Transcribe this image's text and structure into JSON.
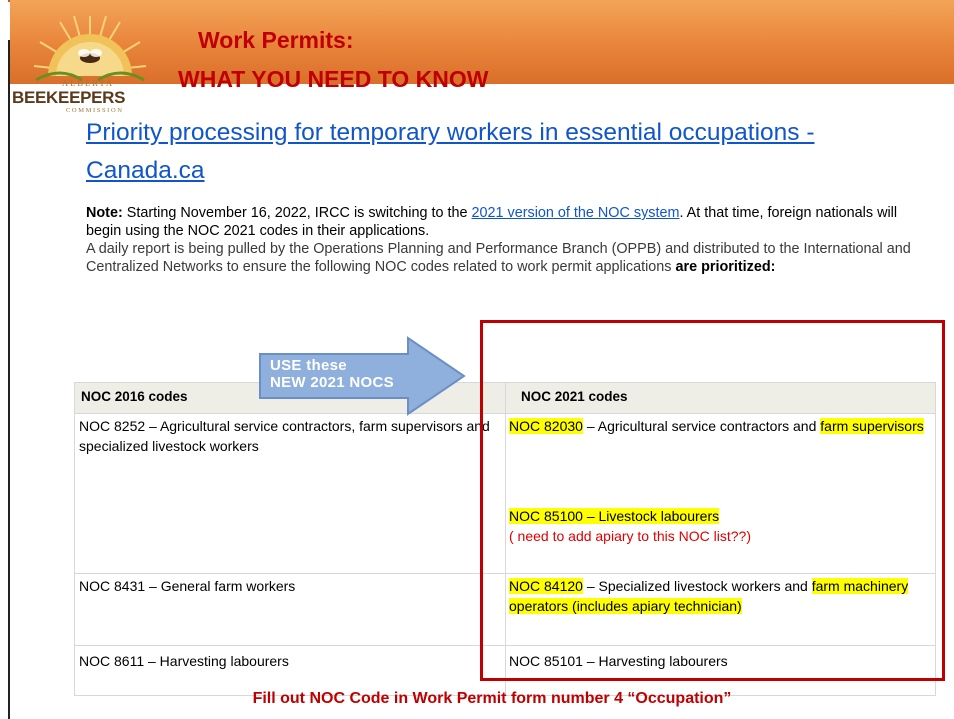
{
  "header": {
    "title_line1": "Work Permits:",
    "title_line2": "WHAT YOU NEED TO KNOW"
  },
  "logo": {
    "alberta": "ALBERTA",
    "beekeepers": "BEEKEEPERS",
    "commission": "COMMISSION"
  },
  "link_title": "Priority processing for temporary workers in essential occupations - Canada.ca",
  "note": {
    "label": "Note:",
    "text1": " Starting November 16, 2022, IRCC is switching to the ",
    "link": "2021 version of the NOC system",
    "text2": ". At that time, foreign nationals will begin using the NOC 2021 codes in their applications.",
    "text3": "A daily report is being pulled by the Operations Planning and Performance Branch (OPPB) and distributed to the International and Centralized Networks to ensure the following NOC codes related to work permit applications ",
    "bold_end": "are prioritized:"
  },
  "arrow": {
    "text": "USE these\nNEW 2021 NOCS"
  },
  "table": {
    "headers": [
      "NOC 2016 codes",
      "NOC 2021 codes"
    ],
    "rows": [
      {
        "left": "NOC 8252 – Agricultural service contractors, farm supervisors and specialized livestock workers",
        "right": [
          {
            "hl1": "NOC 82030",
            "t1": " – Agricultural service contractors and ",
            "hl2": "farm supervisors"
          },
          {
            "hl1": "NOC 85100 – Livestock labourers",
            "note": "( need to add apiary to this NOC list??)"
          }
        ]
      },
      {
        "left": "NOC 8431 – General farm workers",
        "right": [
          {
            "hl1": "NOC 84120",
            "t1": " – Specialized livestock workers and ",
            "hl2": "farm machinery operators (includes apiary technician)"
          }
        ]
      },
      {
        "left": "NOC 8611 – Harvesting labourers",
        "right": [
          {
            "t1": "NOC 85101 – Harvesting labourers"
          }
        ]
      }
    ]
  },
  "footer": "Fill out NOC Code in Work Permit form number 4 “Occupation”",
  "colors": {
    "header_orange": "#e8843a",
    "title_red": "#c00000",
    "link_blue": "#1155cc",
    "highlight": "#ffff00",
    "arrow_blue": "#8fb0dc"
  }
}
